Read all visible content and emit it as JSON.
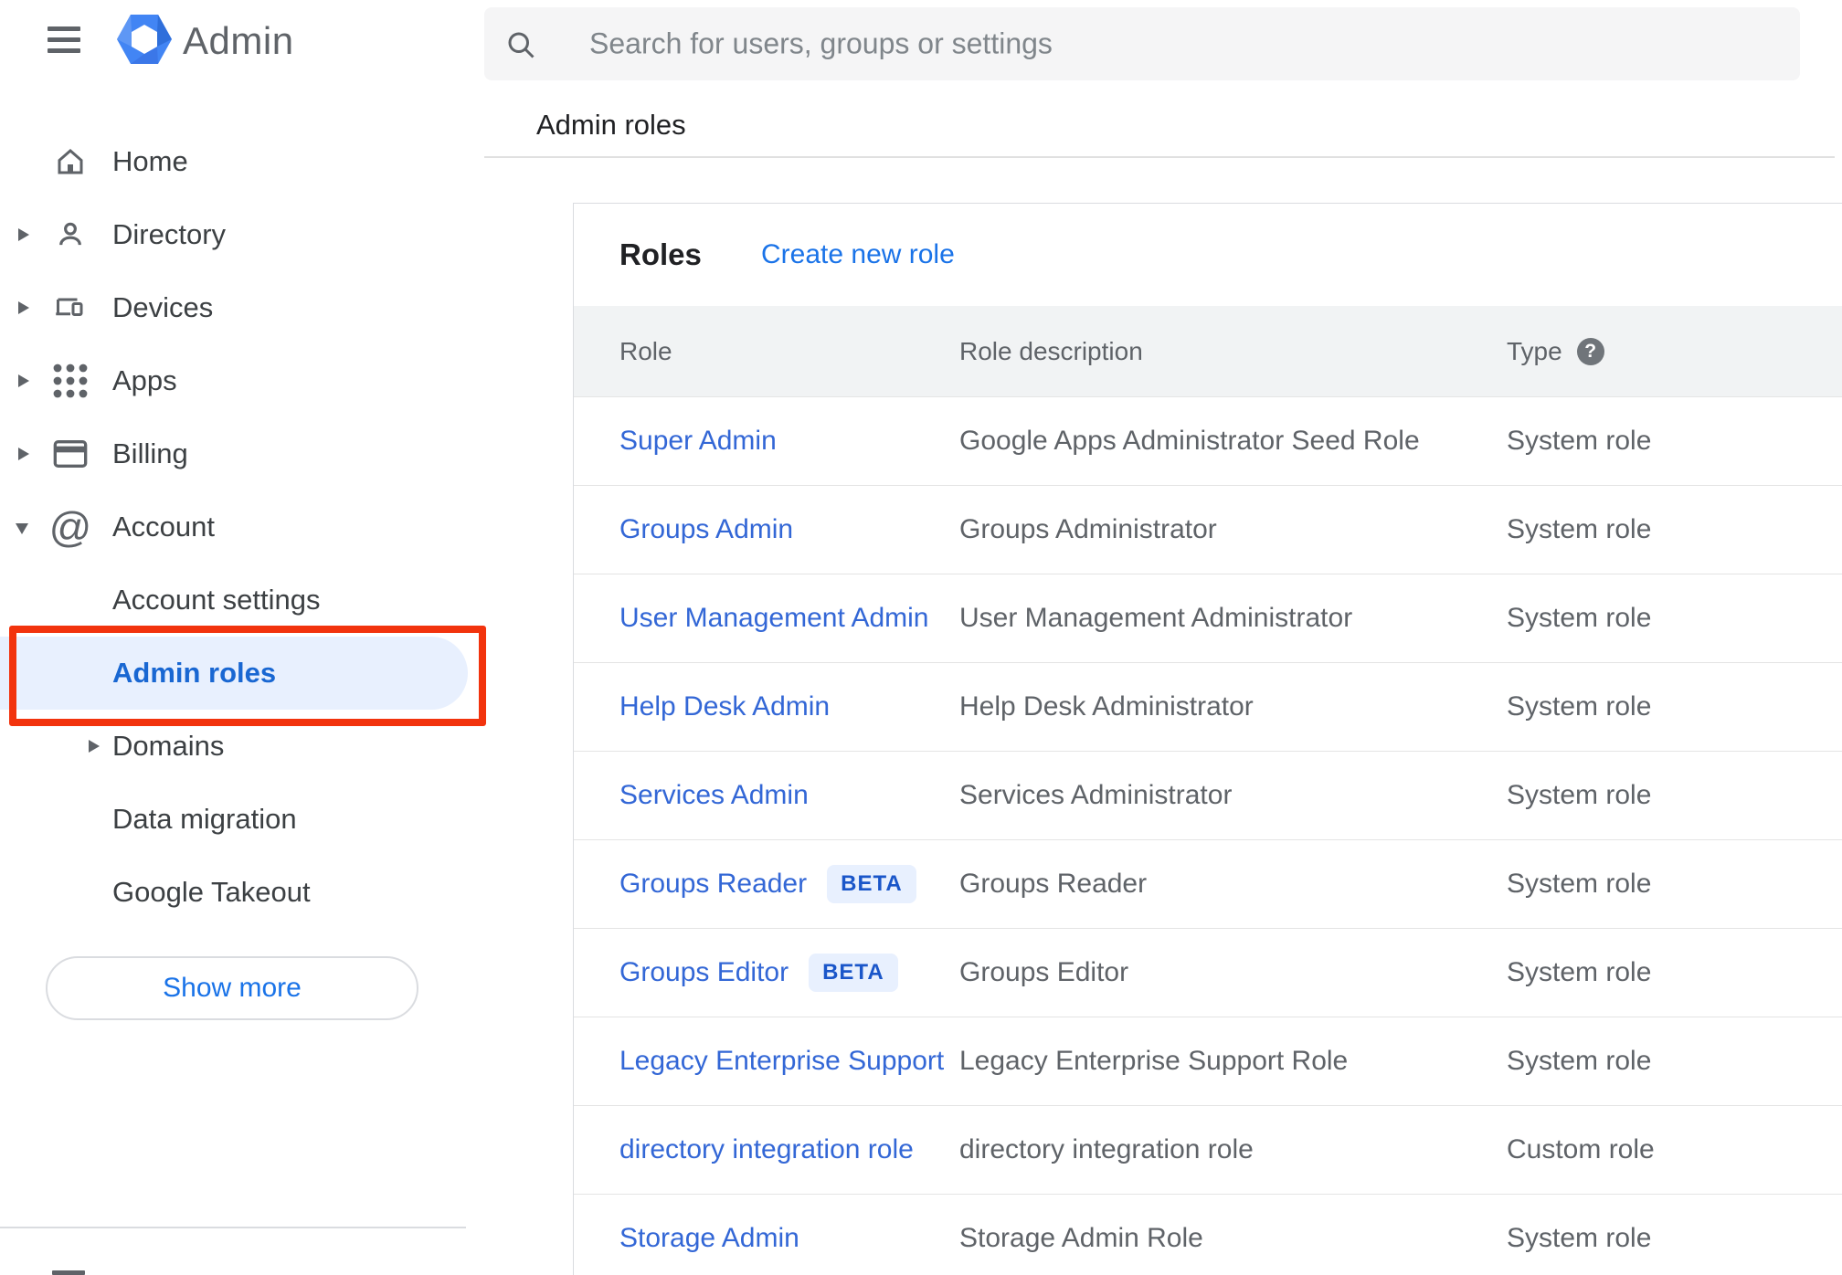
{
  "app": {
    "product_name": "Admin"
  },
  "search": {
    "placeholder": "Search for users, groups or settings"
  },
  "breadcrumb": "Admin roles",
  "sidebar": {
    "items": [
      {
        "label": "Home"
      },
      {
        "label": "Directory"
      },
      {
        "label": "Devices"
      },
      {
        "label": "Apps"
      },
      {
        "label": "Billing"
      },
      {
        "label": "Account"
      }
    ],
    "account_children": [
      {
        "label": "Account settings"
      },
      {
        "label": "Admin roles",
        "selected": true
      },
      {
        "label": "Domains"
      },
      {
        "label": "Data migration"
      },
      {
        "label": "Google Takeout"
      }
    ],
    "show_more_label": "Show more"
  },
  "main": {
    "card_title": "Roles",
    "create_link": "Create new role",
    "table": {
      "columns": [
        "Role",
        "Role description",
        "Type"
      ],
      "beta_label": "BETA",
      "rows": [
        {
          "role": "Super Admin",
          "beta": false,
          "description": "Google Apps Administrator Seed Role",
          "type": "System role"
        },
        {
          "role": "Groups Admin",
          "beta": false,
          "description": "Groups Administrator",
          "type": "System role"
        },
        {
          "role": "User Management Admin",
          "beta": false,
          "description": "User Management Administrator",
          "type": "System role"
        },
        {
          "role": "Help Desk Admin",
          "beta": false,
          "description": "Help Desk Administrator",
          "type": "System role"
        },
        {
          "role": "Services Admin",
          "beta": false,
          "description": "Services Administrator",
          "type": "System role"
        },
        {
          "role": "Groups Reader",
          "beta": true,
          "description": "Groups Reader",
          "type": "System role"
        },
        {
          "role": "Groups Editor",
          "beta": true,
          "description": "Groups Editor",
          "type": "System role"
        },
        {
          "role": "Legacy Enterprise Support",
          "beta": false,
          "description": "Legacy Enterprise Support Role",
          "type": "System role"
        },
        {
          "role": "directory integration role",
          "beta": false,
          "description": "directory integration role",
          "type": "Custom role"
        },
        {
          "role": "Storage Admin",
          "beta": false,
          "description": "Storage Admin Role",
          "type": "System role"
        }
      ]
    }
  },
  "colors": {
    "selected_item_text": "#1967D2",
    "selected_item_pill": "#E8F0FE",
    "annotation_red": "#F2330D",
    "link_blue": "#1A73E8",
    "role_link_blue": "#3367D6",
    "beta_badge_bg": "#E8F0FE",
    "beta_badge_text": "#1A56C9",
    "header_band_bg": "#F1F3F4",
    "logo_blue": "#4285F4"
  }
}
